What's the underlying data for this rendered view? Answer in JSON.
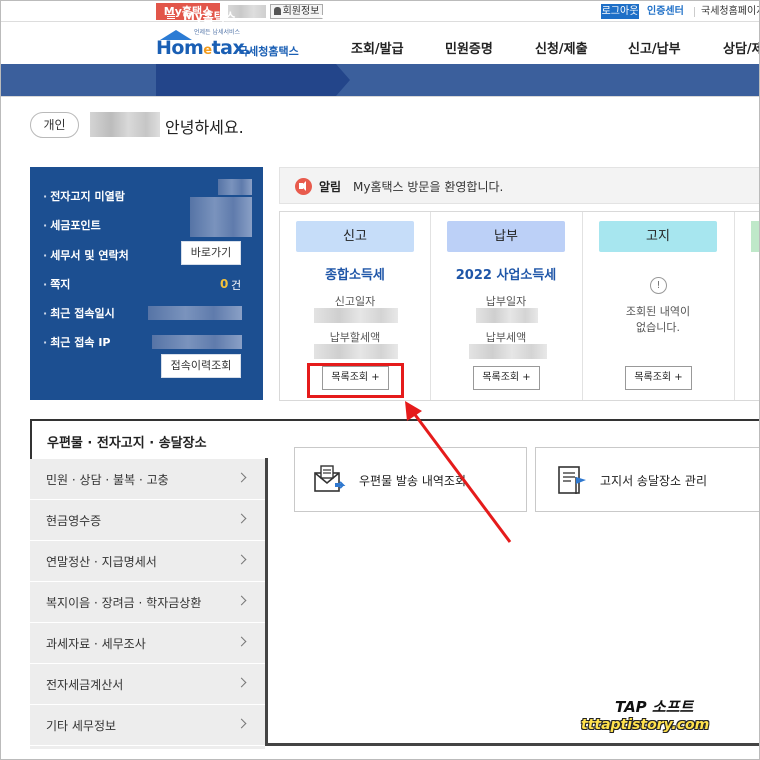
{
  "topbar": {
    "myhometax": "My홈택스",
    "member_info": "회원정보",
    "logout": "로그아웃",
    "cert_center": "인증센터",
    "other_site": "국세청홈페이지"
  },
  "logo": {
    "sub": "언제든 납세서비스",
    "word": "Hom",
    "e": "e",
    "word2": "tax.",
    "kor": "국세청홈택스"
  },
  "gnb": [
    "조회/발급",
    "민원증명",
    "신청/제출",
    "신고/납부",
    "상담/제보"
  ],
  "nav": {
    "menu": "My홈택스"
  },
  "greeting": {
    "type": "개인",
    "text": "안녕하세요."
  },
  "info": {
    "items": [
      "전자고지 미열람",
      "세금포인트",
      "세무서 및 연락처",
      "쪽지",
      "최근 접속일시",
      "최근 접속 IP"
    ],
    "shortcut_btn": "바로가기",
    "note_count": "0",
    "note_unit": "건",
    "history_btn": "접속이력조회"
  },
  "notice": {
    "label": "알림",
    "message": "My홈택스 방문을 환영합니다."
  },
  "cards": [
    {
      "tab": "신고",
      "title": "종합소득세",
      "label1": "신고일자",
      "label2": "납부할세액",
      "button": "목록조회 +",
      "color": "#c6ddf9"
    },
    {
      "tab": "납부",
      "title": "2022 사업소득세",
      "label1": "납부일자",
      "label2": "납부세액",
      "button": "목록조회 +",
      "color": "#bcd0f7"
    },
    {
      "tab": "고지",
      "excl": "!",
      "empty1": "조회된 내역이",
      "empty2": "없습니다.",
      "button": "목록조회 +",
      "color": "#a7e6ef"
    }
  ],
  "lower": {
    "section_title": "우편물 · 전자고지 · 송달장소",
    "side_items": [
      "민원 · 상담 · 불복 · 고충",
      "현금영수증",
      "연말정산 · 지급명세서",
      "복지이음 · 장려금 · 학자금상환",
      "과세자료 · 세무조사",
      "전자세금계산서",
      "기타 세무정보"
    ],
    "tiles": [
      "우편물 발송 내역조회",
      "고지서 송달장소 관리"
    ]
  },
  "watermark": {
    "line1": "TAP 소프트",
    "line2": "tttaptistory.com"
  },
  "colors": {
    "navy": "#1c4f91",
    "nav_band": "#3b5f9c",
    "highlight": "#e51b1b",
    "accent_orange": "#f29b1d"
  }
}
